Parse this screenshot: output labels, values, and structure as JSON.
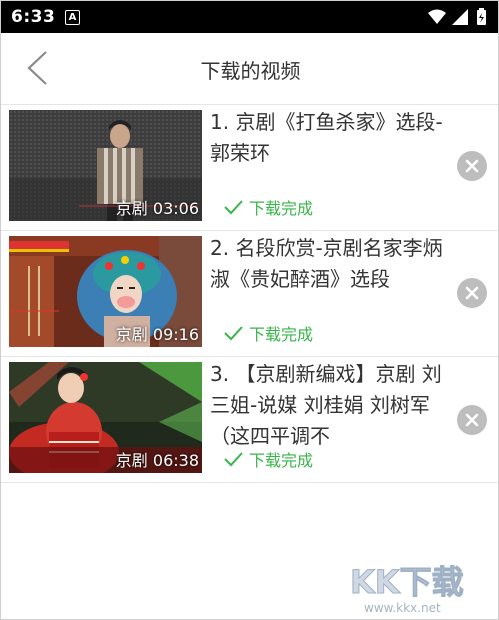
{
  "status_bar": {
    "time": "6:33",
    "notification_letter": "A",
    "icons": [
      "wifi-icon",
      "signal-icon",
      "battery-icon"
    ]
  },
  "header": {
    "title": "下载的视频",
    "back_icon": "chevron-left-icon"
  },
  "videos": [
    {
      "title": "1. 京剧《打鱼杀家》选段-郭荣环",
      "caption": "京剧 03:06",
      "status": "下载完成"
    },
    {
      "title": "2. 名段欣赏-京剧名家李炳淑《贵妃醉酒》选段",
      "caption": "京剧 09:16",
      "status": "下载完成"
    },
    {
      "title": "3. 【京剧新编戏】京剧 刘三姐-说媒 刘桂娟 刘树军 （这四平调不",
      "caption": "京剧 06:38",
      "status": "下载完成"
    }
  ],
  "watermark": {
    "brand": "KK下载",
    "url": "www.kkx.net"
  },
  "colors": {
    "status_green": "#39b54a",
    "delete_gray": "#bdbdbd",
    "status_bar_bg": "#000000"
  }
}
